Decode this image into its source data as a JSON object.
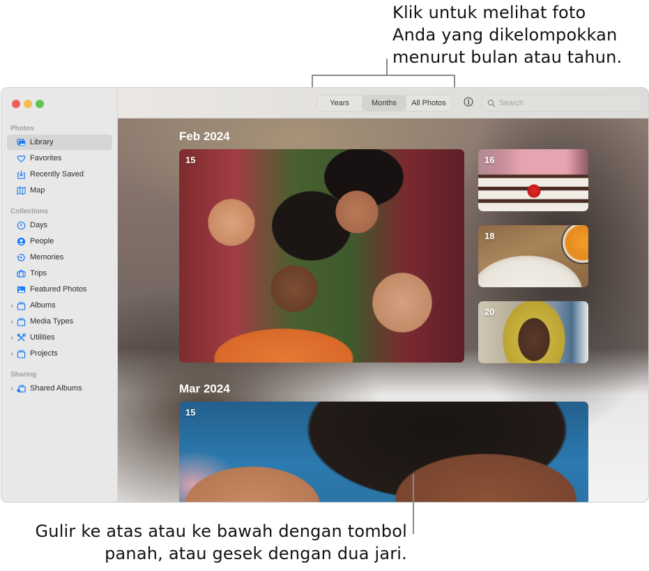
{
  "callouts": {
    "top": [
      "Klik untuk melihat foto",
      "Anda yang dikelompokkan",
      "menurut bulan atau tahun."
    ],
    "bottom": [
      "Gulir ke atas atau ke bawah dengan tombol",
      "panah, atau gesek dengan dua jari."
    ]
  },
  "window": {
    "traffic_lights": {
      "close": "#ee5f57",
      "minimize": "#f4bd4f",
      "zoom": "#61c454"
    }
  },
  "sidebar": {
    "sections": [
      {
        "title": "Photos",
        "items": [
          {
            "label": "Library",
            "icon": "photo-library-icon",
            "active": true
          },
          {
            "label": "Favorites",
            "icon": "heart-icon"
          },
          {
            "label": "Recently Saved",
            "icon": "download-tray-icon"
          },
          {
            "label": "Map",
            "icon": "map-icon"
          }
        ]
      },
      {
        "title": "Collections",
        "items": [
          {
            "label": "Days",
            "icon": "clock-icon"
          },
          {
            "label": "People",
            "icon": "person-circle-icon"
          },
          {
            "label": "Memories",
            "icon": "memories-icon"
          },
          {
            "label": "Trips",
            "icon": "suitcase-icon"
          },
          {
            "label": "Featured Photos",
            "icon": "photo-icon"
          },
          {
            "label": "Albums",
            "icon": "folder-stack-icon",
            "expandable": true
          },
          {
            "label": "Media Types",
            "icon": "folder-stack-icon",
            "expandable": true
          },
          {
            "label": "Utilities",
            "icon": "tools-icon",
            "expandable": true
          },
          {
            "label": "Projects",
            "icon": "folder-stack-icon",
            "expandable": true
          }
        ]
      },
      {
        "title": "Sharing",
        "items": [
          {
            "label": "Shared Albums",
            "icon": "shared-album-icon",
            "expandable": true
          }
        ]
      }
    ]
  },
  "toolbar": {
    "view_tabs": [
      {
        "label": "Years"
      },
      {
        "label": "Months",
        "selected": true
      },
      {
        "label": "All Photos"
      }
    ],
    "info_icon": "info-circle-icon",
    "search": {
      "placeholder": "Search",
      "value": ""
    }
  },
  "content": {
    "months": [
      {
        "title": "Feb 2024",
        "photos": [
          {
            "day": "15",
            "subject": "group selfie"
          },
          {
            "day": "16",
            "subject": "cake slice"
          },
          {
            "day": "18",
            "subject": "food plates"
          },
          {
            "day": "20",
            "subject": "person in yellow hood"
          }
        ]
      },
      {
        "title": "Mar 2024",
        "photos": [
          {
            "day": "15",
            "subject": "two people close-up"
          }
        ]
      }
    ]
  },
  "colors": {
    "accent": "#1a7cf5"
  }
}
